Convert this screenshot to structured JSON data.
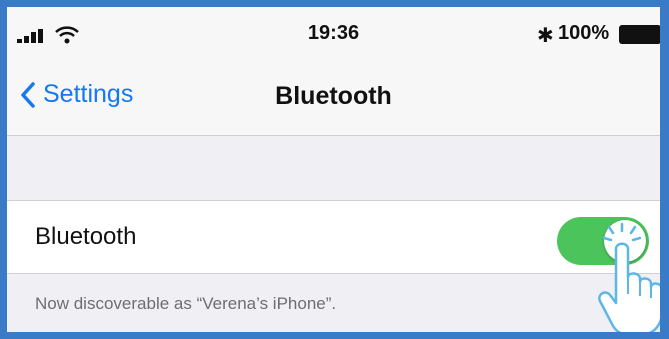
{
  "status_bar": {
    "time": "19:36",
    "bluetooth_icon": "bluetooth-icon",
    "battery_percent": "100%",
    "signal_icon": "cellular-signal-icon",
    "wifi_icon": "wifi-icon",
    "battery_icon": "battery-full-icon"
  },
  "nav": {
    "back_label": "Settings",
    "title": "Bluetooth"
  },
  "bluetooth_cell": {
    "label": "Bluetooth",
    "toggle_on": true
  },
  "footer": {
    "text": "Now discoverable as “Verena’s iPhone”."
  },
  "colors": {
    "accent": "#1578f2",
    "toggle_on": "#4cc45c",
    "frame": "#3a7bc8",
    "hand_stroke": "#5bb8e6"
  }
}
